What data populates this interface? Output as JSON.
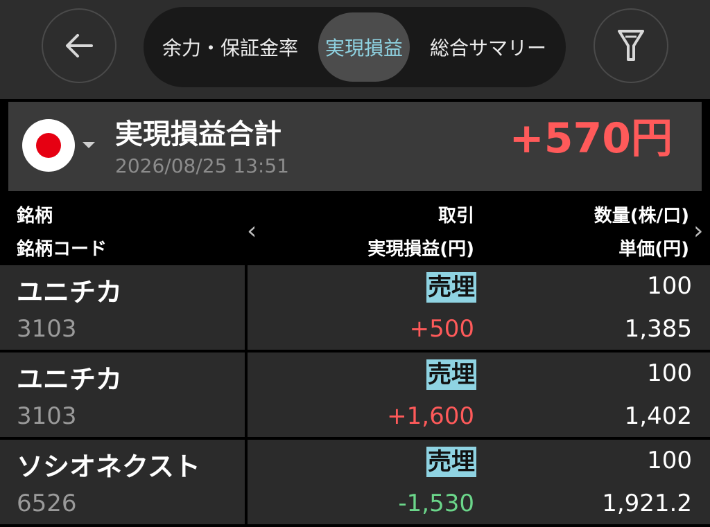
{
  "header": {
    "tabs": [
      {
        "label": "余力・保証金率"
      },
      {
        "label": "実現損益",
        "active": true
      },
      {
        "label": "総合サマリー"
      }
    ],
    "icons": {
      "back": "arrow-left-icon",
      "filter": "filter-icon"
    }
  },
  "summary": {
    "title": "実現損益合計",
    "datetime": "2026/08/25 13:51",
    "total": "+570円",
    "market_flag": "japan-flag-icon",
    "total_color": "#ff5a5a"
  },
  "columns": {
    "name": "銘柄",
    "code": "銘柄コード",
    "side": "取引",
    "pnl": "実現損益(円)",
    "qty": "数量(株/口)",
    "price": "単価(円)"
  },
  "rows": [
    {
      "name": "ユニチカ",
      "code": "3103",
      "side": "売埋",
      "pnl": "+500",
      "qty": "100",
      "price": "1,385"
    },
    {
      "name": "ユニチカ",
      "code": "3103",
      "side": "売埋",
      "pnl": "+1,600",
      "qty": "100",
      "price": "1,402"
    },
    {
      "name": "ソシオネクスト",
      "code": "6526",
      "side": "売埋",
      "pnl": "-1,530",
      "qty": "100",
      "price": "1,921.2"
    }
  ],
  "colors": {
    "accent": "#8fd3e2",
    "profit": "#ff5a5a",
    "loss": "#6bd68a"
  }
}
